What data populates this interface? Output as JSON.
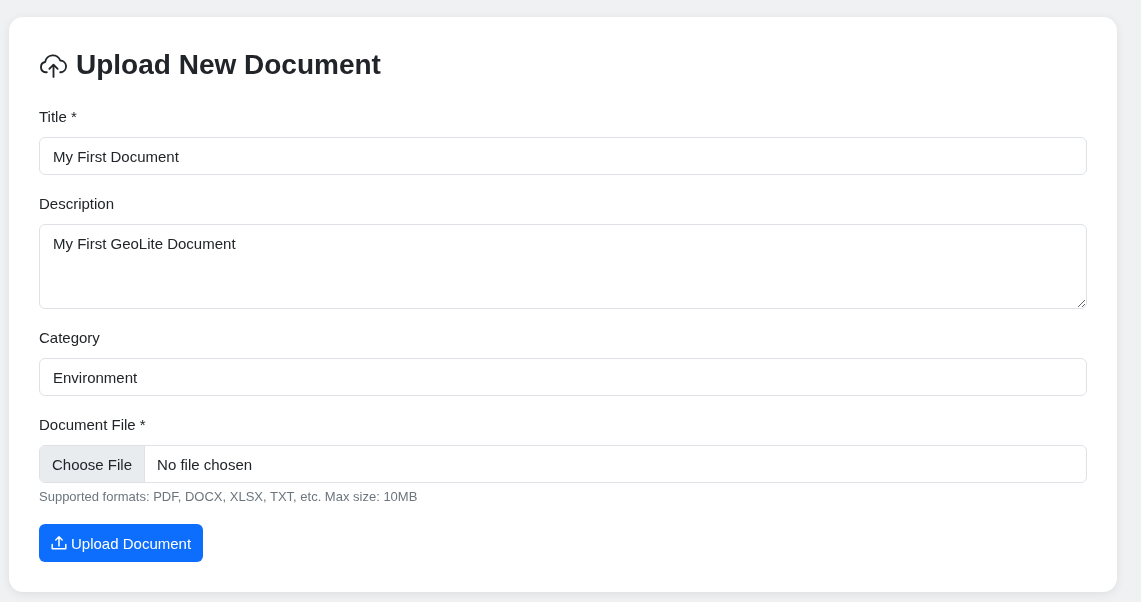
{
  "heading": {
    "title": "Upload New Document"
  },
  "fields": [
    {
      "kind": "text",
      "label": "Title *",
      "value": "My First Document"
    },
    {
      "kind": "textarea",
      "label": "Description",
      "value": "My First GeoLite Document"
    },
    {
      "kind": "text",
      "label": "Category",
      "value": "Environment"
    },
    {
      "kind": "file",
      "label": "Document File *",
      "button": "Choose File",
      "value": "No file chosen",
      "hint": "Supported formats: PDF, DOCX, XLSX, TXT, etc. Max size: 10MB"
    }
  ],
  "submit_button": {
    "label": "Upload Document"
  }
}
